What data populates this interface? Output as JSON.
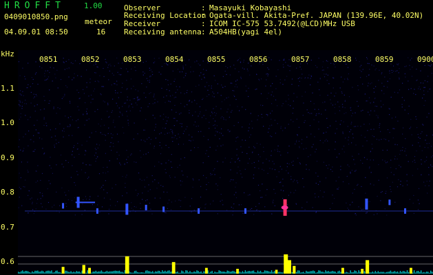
{
  "header": {
    "app_title": "HROFFT",
    "app_version": "1.00",
    "file_name": "0409010850.png",
    "datetime": "04.09.01 08:50",
    "meteor_label": "meteor",
    "meteor_count": "16"
  },
  "info": [
    {
      "label": "Observer",
      "value": "Masayuki Kobayashi"
    },
    {
      "label": "Receiving Location",
      "value": "Ogata-vill. Akita-Pref. JAPAN (139.96E, 40.02N)"
    },
    {
      "label": "Receiver",
      "value": "ICOM IC-575 53.7492(@LCD)MHz USB"
    },
    {
      "label": "Receiving antenna",
      "value": "A504HB(yagi 4el)"
    }
  ],
  "colors": {
    "background": "#000000",
    "text": "#ffff66",
    "title": "#22dd44",
    "noise": "#1a1a7a",
    "echo": "#3355ff",
    "hot": "#ff3366",
    "bar": "#ffff00",
    "bar_base": "#00ffff"
  },
  "chart_data": {
    "type": "heatmap",
    "ylabel": "kHz",
    "y_ticks": [
      "1.1",
      "1.0",
      "0.9",
      "0.8",
      "0.7",
      "0.6"
    ],
    "x_ticks": [
      "0851",
      "0852",
      "0853",
      "0854",
      "0855",
      "0856",
      "0857",
      "0858",
      "0859",
      "0900"
    ],
    "ylim": [
      0.58,
      1.2
    ],
    "xlim": [
      0,
      10
    ],
    "carrier_khz": 0.745,
    "echoes": [
      {
        "x": 0.62,
        "f": 0.76,
        "strength": 1
      },
      {
        "x": 1.0,
        "f": 0.77,
        "strength": 2
      },
      {
        "x": 1.5,
        "f": 0.745,
        "strength": 1
      },
      {
        "x": 2.25,
        "f": 0.75,
        "strength": 2
      },
      {
        "x": 2.75,
        "f": 0.755,
        "strength": 1
      },
      {
        "x": 3.2,
        "f": 0.75,
        "strength": 1
      },
      {
        "x": 4.1,
        "f": 0.745,
        "strength": 1
      },
      {
        "x": 5.3,
        "f": 0.745,
        "strength": 1
      },
      {
        "x": 6.3,
        "f": 0.755,
        "strength": 3
      },
      {
        "x": 8.4,
        "f": 0.765,
        "strength": 2
      },
      {
        "x": 9.0,
        "f": 0.77,
        "strength": 1
      },
      {
        "x": 9.4,
        "f": 0.745,
        "strength": 1
      }
    ],
    "activity_bars": [
      {
        "x": 0.62,
        "h": 0.35
      },
      {
        "x": 1.15,
        "h": 0.45
      },
      {
        "x": 1.3,
        "h": 0.3
      },
      {
        "x": 2.25,
        "h": 0.9
      },
      {
        "x": 3.45,
        "h": 0.6
      },
      {
        "x": 4.3,
        "h": 0.3
      },
      {
        "x": 5.1,
        "h": 0.25
      },
      {
        "x": 6.1,
        "h": 0.2
      },
      {
        "x": 6.32,
        "h": 1.0
      },
      {
        "x": 6.42,
        "h": 0.7
      },
      {
        "x": 6.55,
        "h": 0.4
      },
      {
        "x": 7.8,
        "h": 0.3
      },
      {
        "x": 8.3,
        "h": 0.25
      },
      {
        "x": 8.42,
        "h": 0.7
      },
      {
        "x": 9.55,
        "h": 0.3
      }
    ]
  }
}
